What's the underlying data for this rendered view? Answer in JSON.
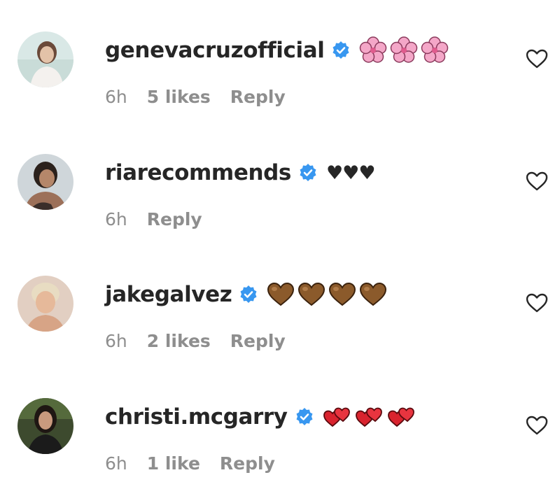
{
  "comments": [
    {
      "username": "genevacruzofficial",
      "verified": true,
      "emoji": "cherry-blossom",
      "emoji_count": 3,
      "time": "6h",
      "likes": "5 likes",
      "reply": "Reply"
    },
    {
      "username": "riarecommends",
      "verified": true,
      "text": "♥♥♥",
      "time": "6h",
      "likes": "",
      "reply": "Reply"
    },
    {
      "username": "jakegalvez",
      "verified": true,
      "emoji": "brown-heart",
      "emoji_count": 4,
      "time": "6h",
      "likes": "2 likes",
      "reply": "Reply"
    },
    {
      "username": "christi.mcgarry",
      "verified": true,
      "emoji": "two-hearts-red",
      "emoji_count": 3,
      "time": "6h",
      "likes": "1 like",
      "reply": "Reply"
    }
  ],
  "colors": {
    "username": "#262626",
    "meta": "#8e8e8e",
    "verified": "#3897f0",
    "brown_heart": "#8b5a2b",
    "red_heart": "#d9232e",
    "blossom": "#f4a7c8"
  },
  "icons": {
    "like": "heart-outline-icon",
    "verified": "verified-badge-icon"
  }
}
